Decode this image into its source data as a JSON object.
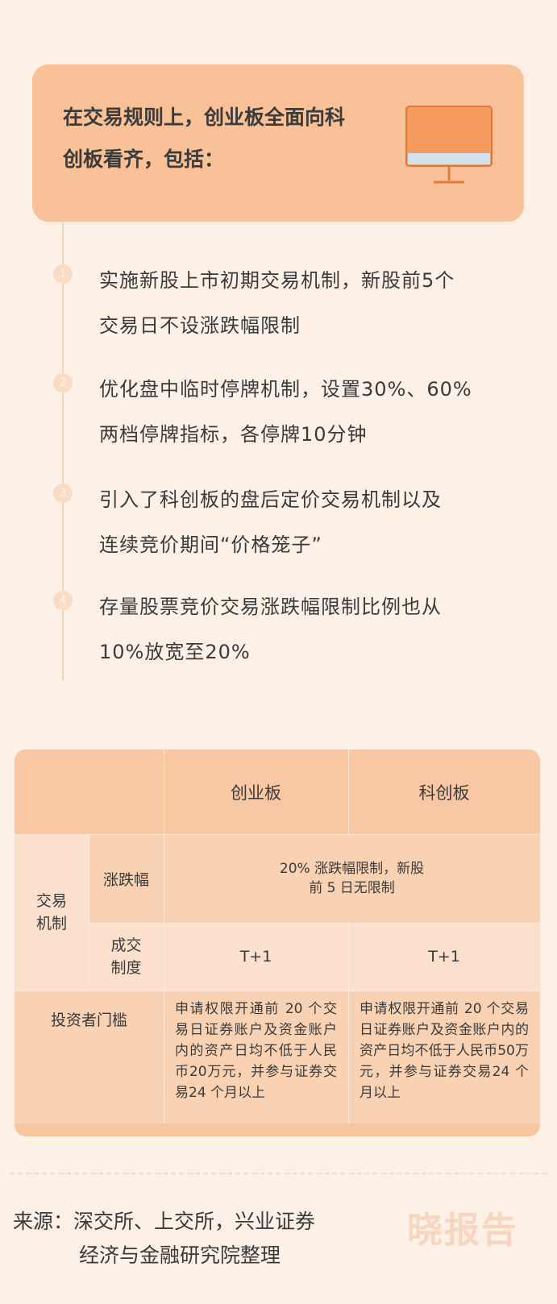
{
  "header": {
    "line1": "在交易规则上，创业板全面向科",
    "line2": "创板看齐，包括：",
    "icon": "monitor-icon"
  },
  "steps": [
    {
      "num": "1",
      "line1": "实施新股上市初期交易机制，新股前5个",
      "line2": "交易日不设涨跌幅限制"
    },
    {
      "num": "2",
      "line1": "优化盘中临时停牌机制，设置30%、60%",
      "line2": "两档停牌指标，各停牌10分钟"
    },
    {
      "num": "3",
      "line1": "引入了科创板的盘后定价交易机制以及",
      "line2": "连续竞价期间“价格笼子”"
    },
    {
      "num": "4",
      "line1": "存量股票竞价交易涨跌幅限制比例也从",
      "line2": "10%放宽至20%"
    }
  ],
  "table": {
    "col_chuangye": "创业板",
    "col_kechuang": "科创板",
    "group_trade": "交易机制",
    "row_limit": "涨跌幅",
    "row_limit_value_1": "20% 涨跌幅限制，新股",
    "row_limit_value_2": "前 5 日无限制",
    "row_settle_1": "成交",
    "row_settle_2": "制度",
    "settle_chuangye": "T+1",
    "settle_kechuang": "T+1",
    "row_investor": "投资者门槛",
    "investor_chuangye": "申请权限开通前 20 个交易日证券账户及资金账户内的资产日均不低于人民币20万元，并参与证券交易24 个月以上",
    "investor_kechuang": "申请权限开通前 20 个交易日证券账户及资金账户内的资产日均不低于人民币50万元，并参与证券交易24 个月以上"
  },
  "footer": {
    "source_line1": "来源：深交所、上交所，兴业证券",
    "source_line2": "经济与金融研究院整理",
    "brand": "晓报告"
  }
}
